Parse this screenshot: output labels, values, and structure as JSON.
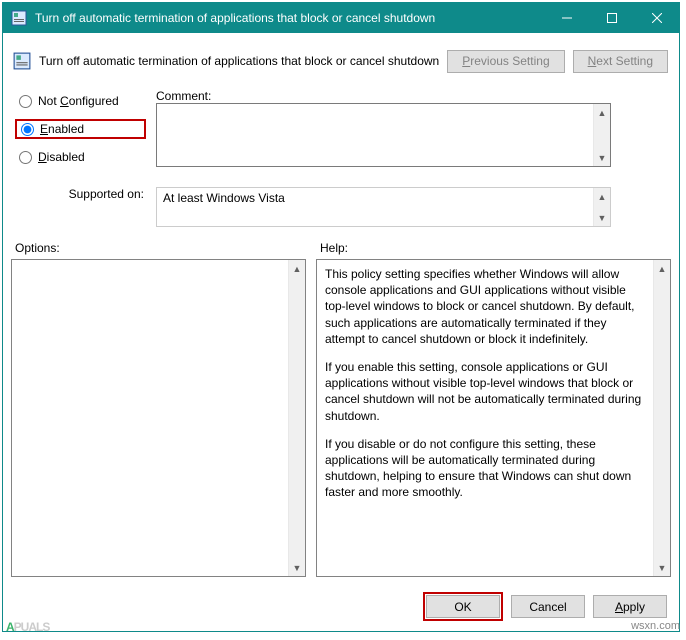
{
  "window": {
    "title": "Turn off automatic termination of applications that block or cancel shutdown"
  },
  "header": {
    "policy_title": "Turn off automatic termination of applications that block or cancel shutdown",
    "previous_setting": "Previous Setting",
    "next_setting": "Next Setting"
  },
  "radios": {
    "not_configured": "Not Configured",
    "enabled": "Enabled",
    "disabled": "Disabled"
  },
  "labels": {
    "comment": "Comment:",
    "supported_on": "Supported on:",
    "options": "Options:",
    "help": "Help:"
  },
  "supported_text": "At least Windows Vista",
  "help": {
    "p1": "This policy setting specifies whether Windows will allow console applications and GUI applications without visible top-level windows to block or cancel shutdown. By default, such applications are automatically terminated if they attempt to cancel shutdown or block it indefinitely.",
    "p2": "If you enable this setting, console applications or GUI applications without visible top-level windows that block or cancel shutdown will not be automatically terminated during shutdown.",
    "p3": "If you disable or do not configure this setting, these applications will be automatically terminated during shutdown, helping to ensure that Windows can shut down faster and more smoothly."
  },
  "buttons": {
    "ok": "OK",
    "cancel": "Cancel",
    "apply": "Apply"
  },
  "watermark": {
    "brand_prefix": "A",
    "brand_suffix": "PUALS",
    "site": "wsxn.com"
  }
}
